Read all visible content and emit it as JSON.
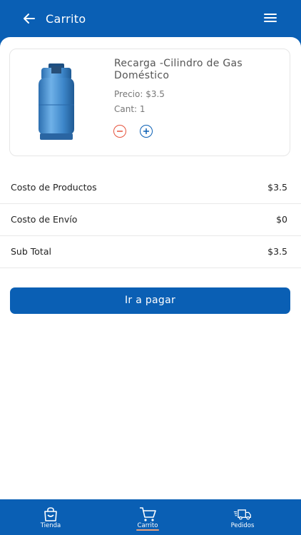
{
  "header": {
    "title": "Carrito"
  },
  "product": {
    "name": "Recarga -Cilindro de Gas Doméstico",
    "price": "Precio: $3.5",
    "quantity": "Cant: 1"
  },
  "summary": {
    "rows": [
      {
        "label": "Costo de Productos",
        "value": "$3.5"
      },
      {
        "label": "Costo de Envío",
        "value": "$0"
      },
      {
        "label": "Sub Total",
        "value": "$3.5"
      }
    ]
  },
  "pay_button": {
    "label": "Ir a pagar"
  },
  "nav": {
    "items": [
      {
        "label": "Tienda",
        "icon": "shopping-bag-icon"
      },
      {
        "label": "Carrito",
        "icon": "cart-icon"
      },
      {
        "label": "Pedidos",
        "icon": "delivery-truck-icon"
      }
    ]
  },
  "colors": {
    "primary": "#0a5fb4",
    "minus": "#e5533d",
    "active_indicator": "#e9a07a"
  }
}
